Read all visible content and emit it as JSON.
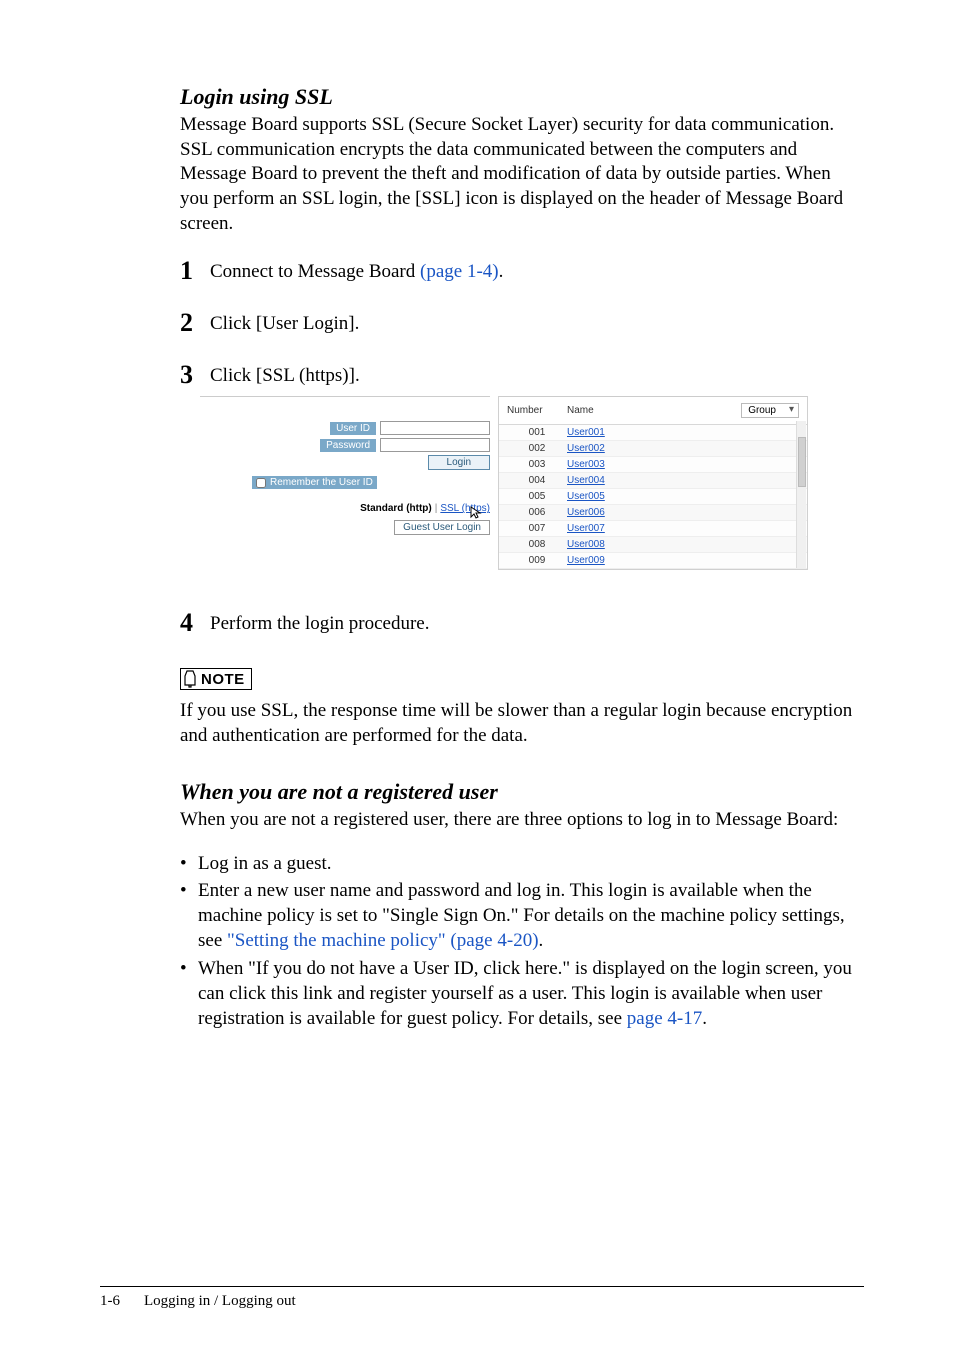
{
  "section1": {
    "title": "Login using SSL",
    "para": "Message Board supports SSL (Secure Socket Layer) security for data communication. SSL communication encrypts the data communicated between the computers and Message Board to prevent the theft and modification of data by outside parties. When you perform an SSL login, the [SSL] icon is displayed on the header of Message Board screen."
  },
  "steps": {
    "s1a": "Connect to Message Board ",
    "s1b": "(page 1-4)",
    "s1c": ".",
    "s2": "Click [User Login].",
    "s3": "Click [SSL (https)].",
    "s4": "Perform the login procedure."
  },
  "login_panel": {
    "user_id_label": "User ID",
    "password_label": "Password",
    "login_btn": "Login",
    "remember": "Remember the User ID",
    "standard": "Standard (http)",
    "ssl": "SSL (https)",
    "guest": "Guest User Login"
  },
  "table": {
    "head_number": "Number",
    "head_name": "Name",
    "group_select": "Group",
    "rows": [
      {
        "num": "001",
        "name": "User001"
      },
      {
        "num": "002",
        "name": "User002"
      },
      {
        "num": "003",
        "name": "User003"
      },
      {
        "num": "004",
        "name": "User004"
      },
      {
        "num": "005",
        "name": "User005"
      },
      {
        "num": "006",
        "name": "User006"
      },
      {
        "num": "007",
        "name": "User007"
      },
      {
        "num": "008",
        "name": "User008"
      },
      {
        "num": "009",
        "name": "User009"
      }
    ]
  },
  "note": {
    "label": "NOTE",
    "text": "If you use SSL, the response time will be slower than a regular login because encryption and authentication are performed for the data."
  },
  "section2": {
    "title": "When you are not a registered user",
    "para": "When you are not a registered user, there are three options to log in to Message Board:"
  },
  "bullets": {
    "b1": "Log in as a guest.",
    "b2a": "Enter a new user name and password and log in.  This login is available when the machine policy is set to \"Single Sign On.\"  For details on the machine policy settings, see ",
    "b2b": "\"Setting the machine policy\" (page 4-20)",
    "b2c": ".",
    "b3a": "When \"If you do not have a User ID, click here.\" is displayed on the login screen, you can click this link and register yourself as a user.  This login is available when user registration is available for guest policy.  For details, see ",
    "b3b": "page 4-17",
    "b3c": "."
  },
  "footer": {
    "page": "1-6",
    "title": "Logging in / Logging out"
  }
}
